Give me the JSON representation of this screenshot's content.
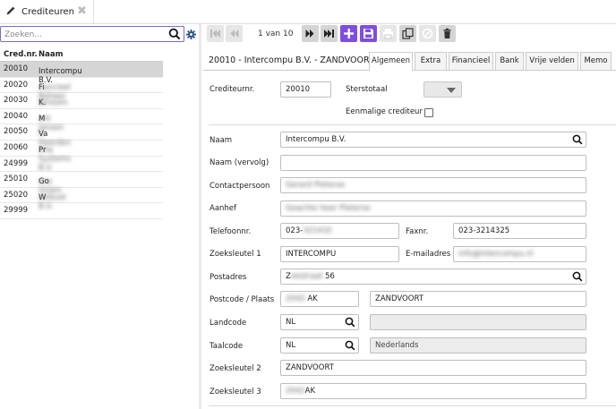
{
  "tab": {
    "title": "Crediteuren"
  },
  "search": {
    "placeholder": "Zoeken..."
  },
  "list": {
    "headers": {
      "code": "Cred.nr.",
      "name": "Naam"
    },
    "rows": [
      {
        "code": "20010",
        "name": "Intercompu B.V.",
        "blurred": ""
      },
      {
        "code": "20020",
        "name": "Fi",
        "blurred": "nancieel Beheer"
      },
      {
        "code": "20030",
        "name": "K.",
        "blurred": "Janssen"
      },
      {
        "code": "20040",
        "name": "M",
        "blurred": "ark Jansen"
      },
      {
        "code": "20050",
        "name": "Va",
        "blurred": "n Heerden"
      },
      {
        "code": "20060",
        "name": "Pr",
        "blurred": "ima Systems B.V."
      },
      {
        "code": "24999",
        "name": "",
        "blurred": ""
      },
      {
        "code": "25010",
        "name": "Go",
        "blurred": "oey Groen"
      },
      {
        "code": "25020",
        "name": "W",
        "blurred": "estkust B.V."
      },
      {
        "code": "29999",
        "name": "",
        "blurred": ""
      }
    ]
  },
  "toolbar": {
    "pager": "1 van 10"
  },
  "record": {
    "title": "20010 - Intercompu B.V. - ZANDVOORT",
    "tabs": [
      "Algemeen",
      "Extra",
      "Financieel",
      "Bank",
      "Vrije velden",
      "Memo"
    ]
  },
  "form": {
    "crediteurnr_label": "Crediteurnr.",
    "crediteurnr": "20010",
    "sterstotaal_label": "Sterstotaal",
    "eenmalig_label": "Eenmalige crediteur",
    "naam_label": "Naam",
    "naam": "Intercompu B.V.",
    "naam_vervolg_label": "Naam (vervolg)",
    "contactpersoon_label": "Contactpersoon",
    "contactpersoon_blur": "Gerard Pieterse",
    "aanhef_label": "Aanhef",
    "aanhef_blur": "Geachte heer Pieterse",
    "telefoon_label": "Telefoonnr.",
    "telefoon": "023-",
    "telefoon_blur": "321432",
    "fax_label": "Faxnr.",
    "fax": "023-3214325",
    "zoek1_label": "Zoeksleutel 1",
    "zoek1": "INTERCOMPU",
    "email_label": "E-mailadres",
    "email_blur": "info@intercompu.nl",
    "postadres_label": "Postadres",
    "postadres_prefix": "Z",
    "postadres_blur": "eestraat",
    "postadres_suffix": "56",
    "postcode_label": "Postcode / Plaats",
    "postcode_blur": "2042",
    "postcode_suffix": "AK",
    "plaats": "ZANDVOORT",
    "landcode_label": "Landcode",
    "landcode": "NL",
    "taalcode_label": "Taalcode",
    "taalcode": "NL",
    "taal": "Nederlands",
    "zoek2_label": "Zoeksleutel 2",
    "zoek2": "ZANDVOORT",
    "zoek3_label": "Zoeksleutel 3",
    "zoek3_blur": "2042",
    "zoek3_suffix": "AK"
  },
  "colors": {
    "accent": "#7e4ee0",
    "selected_row": "#d5d5d5"
  }
}
